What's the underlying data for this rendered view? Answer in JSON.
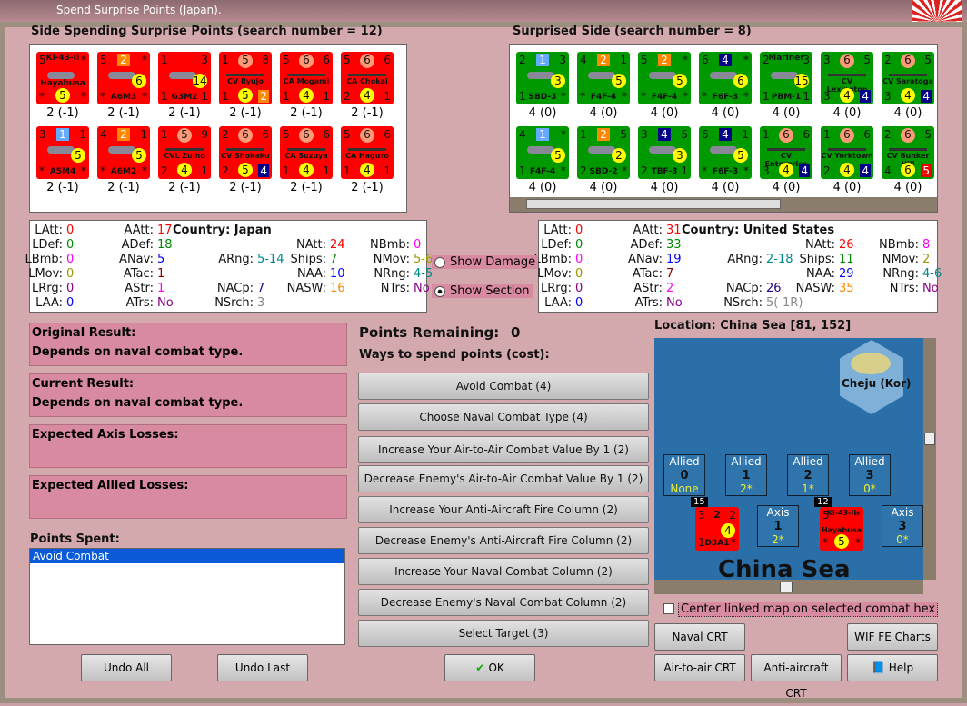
{
  "window": {
    "title": "Spend Surprise Points (Japan)."
  },
  "left_panel": {
    "title": "Side Spending Surprise Points (search number = 12)",
    "counters": [
      {
        "tl": "5",
        "tc": "Ki-43-II",
        "tr": "*",
        "mid": "",
        "name": "Hayabusa",
        "bl": "*",
        "bc": "5",
        "br": "*",
        "type": "plane",
        "value": "2 (-1)"
      },
      {
        "tl": "5",
        "tc": "2",
        "tr": "*",
        "mid": "6",
        "name": "A6M3",
        "bl": "*",
        "bc": "",
        "br": "*",
        "type": "plane",
        "value": "2 (-1)"
      },
      {
        "tl": "1",
        "tc": "",
        "tr": "3",
        "mid": "14",
        "name": "G3M2",
        "bl": "1",
        "bc": "",
        "br": "1",
        "type": "plane",
        "value": "2 (-1)"
      },
      {
        "tl": "1",
        "tc": "5",
        "tr": "8",
        "mid": "",
        "name": "CV Ryujo",
        "bl": "1",
        "bc": "5",
        "br": "2",
        "type": "ship",
        "value": "2 (-1)"
      },
      {
        "tl": "5",
        "tc": "6",
        "tr": "6",
        "mid": "",
        "name": "CA Mogami",
        "bl": "1",
        "bc": "4",
        "br": "1",
        "type": "ship",
        "value": "2 (-1)"
      },
      {
        "tl": "5",
        "tc": "6",
        "tr": "6",
        "mid": "",
        "name": "CA Chokai",
        "bl": "2",
        "bc": "4",
        "br": "1",
        "type": "ship",
        "value": "2 (-1)"
      },
      {
        "tl": "3",
        "tc": "1",
        "tr": "1",
        "mid": "5",
        "name": "A5M4",
        "bl": "*",
        "bc": "",
        "br": "*",
        "type": "plane",
        "value": "2 (-1)"
      },
      {
        "tl": "4",
        "tc": "2",
        "tr": "1",
        "mid": "5",
        "name": "A6M2",
        "bl": "*",
        "bc": "",
        "br": "*",
        "type": "plane",
        "value": "2 (-1)"
      },
      {
        "tl": "1",
        "tc": "5",
        "tr": "9",
        "mid": "",
        "name": "CVL Zuiho",
        "bl": "2",
        "bc": "4",
        "br": "1",
        "type": "ship",
        "value": "2 (-1)"
      },
      {
        "tl": "2",
        "tc": "6",
        "tr": "6",
        "mid": "",
        "name": "CV Shokaku",
        "bl": "2",
        "bc": "5",
        "br": "4",
        "type": "ship",
        "value": "2 (-1)"
      },
      {
        "tl": "5",
        "tc": "6",
        "tr": "6",
        "mid": "",
        "name": "CA Suzuya",
        "bl": "1",
        "bc": "4",
        "br": "1",
        "type": "ship",
        "value": "2 (-1)"
      },
      {
        "tl": "5",
        "tc": "6",
        "tr": "6",
        "mid": "",
        "name": "CA Haguro",
        "bl": "1",
        "bc": "4",
        "br": "1",
        "type": "ship",
        "value": "2 (-1)"
      }
    ]
  },
  "right_panel": {
    "title": "Surprised Side (search number = 8)",
    "counters": [
      {
        "tl": "2",
        "tc": "1",
        "tr": "3",
        "mid": "3",
        "name": "SBD-3",
        "bl": "1",
        "bc": "",
        "br": "*",
        "type": "plane",
        "value": "4 (0)"
      },
      {
        "tl": "4",
        "tc": "2",
        "tr": "1",
        "mid": "5",
        "name": "F4F-4",
        "bl": "*",
        "bc": "",
        "br": "*",
        "type": "plane",
        "value": "4 (0)"
      },
      {
        "tl": "5",
        "tc": "2",
        "tr": "*",
        "mid": "5",
        "name": "F4F-4",
        "bl": "*",
        "bc": "",
        "br": "*",
        "type": "plane",
        "value": "4 (0)"
      },
      {
        "tl": "6",
        "tc": "4",
        "tr": "*",
        "mid": "6",
        "name": "F6F-3",
        "bl": "*",
        "bc": "",
        "br": "*",
        "type": "plane",
        "value": "4 (0)"
      },
      {
        "tl": "2",
        "tc": "Mariner",
        "tr": "3",
        "mid": "15",
        "name": "PBM-1",
        "bl": "1",
        "bc": "",
        "br": "1",
        "type": "plane",
        "value": "4 (0)"
      },
      {
        "tl": "3",
        "tc": "6",
        "tr": "5",
        "mid": "",
        "name": "CV Lexington",
        "bl": "3",
        "bc": "4",
        "br": "4",
        "type": "ship",
        "value": "4 (0)"
      },
      {
        "tl": "2",
        "tc": "6",
        "tr": "5",
        "mid": "",
        "name": "CV Saratoga",
        "bl": "3",
        "bc": "4",
        "br": "4",
        "type": "ship",
        "value": "4 (0)"
      },
      {
        "tl": "4",
        "tc": "1",
        "tr": "*",
        "mid": "5",
        "name": "F4F-4",
        "bl": "1",
        "bc": "",
        "br": "*",
        "type": "plane",
        "value": "4 (0)"
      },
      {
        "tl": "1",
        "tc": "2",
        "tr": "5",
        "mid": "2",
        "name": "SBD-2",
        "bl": "2",
        "bc": "",
        "br": "*",
        "type": "plane",
        "value": "4 (0)"
      },
      {
        "tl": "3",
        "tc": "4",
        "tr": "5",
        "mid": "3",
        "name": "TBF-3",
        "bl": "2",
        "bc": "",
        "br": "1",
        "type": "plane",
        "value": "4 (0)"
      },
      {
        "tl": "6",
        "tc": "4",
        "tr": "1",
        "mid": "5",
        "name": "F6F-3",
        "bl": "*",
        "bc": "",
        "br": "*",
        "type": "plane",
        "value": "4 (0)"
      },
      {
        "tl": "1",
        "tc": "6",
        "tr": "6",
        "mid": "",
        "name": "CV Enterprise",
        "bl": "3",
        "bc": "4",
        "br": "4",
        "type": "ship",
        "value": "4 (0)"
      },
      {
        "tl": "1",
        "tc": "6",
        "tr": "6",
        "mid": "",
        "name": "CV Yorktown",
        "bl": "2",
        "bc": "4",
        "br": "4",
        "type": "ship",
        "value": "4 (0)"
      },
      {
        "tl": "2",
        "tc": "6",
        "tr": "5",
        "mid": "",
        "name": "CV Bunker Hill",
        "bl": "4",
        "bc": "6",
        "br": "5",
        "type": "ship",
        "value": "4 (0)"
      }
    ]
  },
  "stats_left": {
    "country": "Country: Japan",
    "items": [
      [
        "LAtt:",
        "0",
        "#f00"
      ],
      [
        "LDef:",
        "0",
        "#080"
      ],
      [
        "LBmb:",
        "0",
        "#f0f"
      ],
      [
        "LMov:",
        "0",
        "#990"
      ],
      [
        "LRrg:",
        "0",
        "#808"
      ],
      [
        "LAA:",
        "0",
        "#00f"
      ],
      [
        "AAtt:",
        "17",
        "#f00"
      ],
      [
        "ADef:",
        "18",
        "#080"
      ],
      [
        "ANav:",
        "5",
        "#00f"
      ],
      [
        "ATac:",
        "1",
        "#800"
      ],
      [
        "AStr:",
        "1",
        "#f0f"
      ],
      [
        "ATrs:",
        "No",
        "#808"
      ],
      [
        "ARng:",
        "5-14",
        "#088"
      ],
      [
        "NACp:",
        "7",
        "#208"
      ],
      [
        "NSrch:",
        "3",
        "#888"
      ],
      [
        "NAtt:",
        "24",
        "#f00"
      ],
      [
        "Ships:",
        "7",
        "#080"
      ],
      [
        "NAA:",
        "10",
        "#00f"
      ],
      [
        "NASW:",
        "16",
        "#f80"
      ],
      [
        "NBmb:",
        "0",
        "#f0f"
      ],
      [
        "NMov:",
        "5-6",
        "#990"
      ],
      [
        "NRng:",
        "4-5",
        "#088"
      ],
      [
        "NTrs:",
        "No",
        "#808"
      ]
    ]
  },
  "stats_right": {
    "country": "Country: United States",
    "items": [
      [
        "LAtt:",
        "0",
        "#f00"
      ],
      [
        "LDef:",
        "0",
        "#080"
      ],
      [
        "LBmb:",
        "0",
        "#f0f"
      ],
      [
        "LMov:",
        "0",
        "#990"
      ],
      [
        "LRrg:",
        "0",
        "#808"
      ],
      [
        "LAA:",
        "0",
        "#00f"
      ],
      [
        "AAtt:",
        "31",
        "#f00"
      ],
      [
        "ADef:",
        "33",
        "#080"
      ],
      [
        "ANav:",
        "19",
        "#00f"
      ],
      [
        "ATac:",
        "7",
        "#800"
      ],
      [
        "AStr:",
        "2",
        "#f0f"
      ],
      [
        "ATrs:",
        "No",
        "#808"
      ],
      [
        "ARng:",
        "2-18",
        "#088"
      ],
      [
        "NACp:",
        "26",
        "#208"
      ],
      [
        "NSrch:",
        "5(-1R)",
        "#888"
      ],
      [
        "NAtt:",
        "26",
        "#f00"
      ],
      [
        "Ships:",
        "11",
        "#080"
      ],
      [
        "NAA:",
        "29",
        "#00f"
      ],
      [
        "NASW:",
        "35",
        "#f80"
      ],
      [
        "NBmb:",
        "8",
        "#f0f"
      ],
      [
        "NMov:",
        "2",
        "#990"
      ],
      [
        "NRng:",
        "4-6",
        "#088"
      ],
      [
        "NTrs:",
        "No",
        "#808"
      ]
    ]
  },
  "options": {
    "show_damage": "Show Damage",
    "show_section": "Show Section"
  },
  "results": [
    {
      "label": "Original Result:",
      "text": "Depends on naval combat type."
    },
    {
      "label": "Current Result:",
      "text": "Depends on naval combat type."
    },
    {
      "label": "Expected Axis Losses:",
      "text": ""
    },
    {
      "label": "Expected Allied Losses:",
      "text": ""
    }
  ],
  "points_spent": {
    "label": "Points Spent:",
    "items": [
      "Avoid Combat"
    ]
  },
  "points_remaining": {
    "label": "Points Remaining:",
    "value": "0"
  },
  "ways_label": "Ways to spend points (cost):",
  "options_buttons": [
    "Avoid Combat (4)",
    "Choose Naval Combat Type (4)",
    "Increase Your Air-to-Air Combat Value By 1 (2)",
    "Decrease Enemy's Air-to-Air Combat Value By 1 (2)",
    "Increase Your Anti-Aircraft Fire Column (2)",
    "Decrease Enemy's Anti-Aircraft Fire Column (2)",
    "Increase Your Naval Combat Column (2)",
    "Decrease Enemy's Naval Combat Column (2)",
    "Select Target (3)"
  ],
  "map": {
    "location": "Location: China Sea [81, 152]",
    "hex_label": "Cheju (Kor)",
    "sea_label": "China Sea",
    "allied": [
      [
        "Allied",
        "0",
        "None"
      ],
      [
        "Allied",
        "1",
        "2*"
      ],
      [
        "Allied",
        "2",
        "1*"
      ],
      [
        "Allied",
        "3",
        "0*"
      ]
    ],
    "axis": [
      [
        "Axis",
        "1",
        "2*"
      ],
      [
        "Axis",
        "3",
        "0*"
      ]
    ],
    "stack1": {
      "count": "15",
      "tl": "3",
      "tc": "2",
      "tr": "2",
      "mid": "4",
      "bl": "1",
      "name": "D3A1",
      "br": "*"
    },
    "stack2": {
      "count": "12",
      "tl": "5",
      "tc": "Ki-43-II",
      "tr": "*",
      "name": "Hayabusa",
      "bl": "*",
      "bc": "5",
      "br": "*"
    },
    "center_label": "Center linked map on selected combat hex"
  },
  "buttons": {
    "undo_all": "Undo All",
    "undo_last": "Undo Last",
    "ok": "OK",
    "naval_crt": "Naval CRT",
    "wif_charts": "WIF FE Charts",
    "air_crt": "Air-to-air CRT",
    "aa_crt": "Anti-aircraft CRT",
    "help": "Help"
  }
}
